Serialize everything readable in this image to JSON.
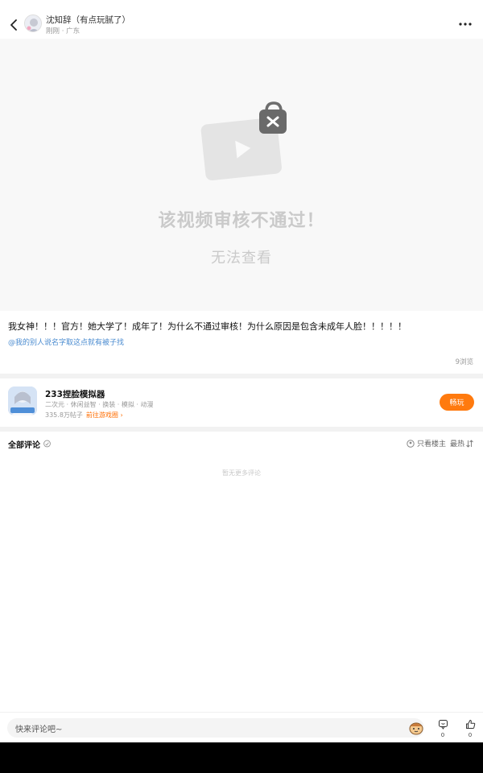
{
  "header": {
    "author_name": "沈知辞（有点玩腻了）",
    "author_sub": "刚刚 · 广东"
  },
  "video": {
    "status_title": "该视频审核不通过！",
    "status_sub": "无法查看"
  },
  "post": {
    "text": "我女神！！！官方！她大学了！成年了！为什么不通过审核！为什么原因是包含未成年人脸！！！！！",
    "link_text": "@我的别人说名字取这点就有被子找",
    "views": "9浏览"
  },
  "game": {
    "name": "233捏脸模拟器",
    "tags": "二次元 · 休闲益智 · 换装 · 模拟 · 动漫",
    "stats": "335.8万帖子",
    "link_label": "前往游戏圈",
    "play_label": "畅玩",
    "accent": "#ff7a0e"
  },
  "comments": {
    "title": "全部评论",
    "filter_label": "只看楼主",
    "sort_label": "最热",
    "empty_text": "暂无更多评论"
  },
  "bottom_bar": {
    "input_placeholder": "快来评论吧~",
    "comment_count": "0",
    "like_count": "0"
  },
  "icons": [
    "back-arrow-icon",
    "more-dots-icon",
    "blocked-video-icon",
    "lock-x-icon",
    "fire-icon",
    "person-icon",
    "sort-icon",
    "emoji-face-icon",
    "comment-icon",
    "thumb-up-icon"
  ]
}
